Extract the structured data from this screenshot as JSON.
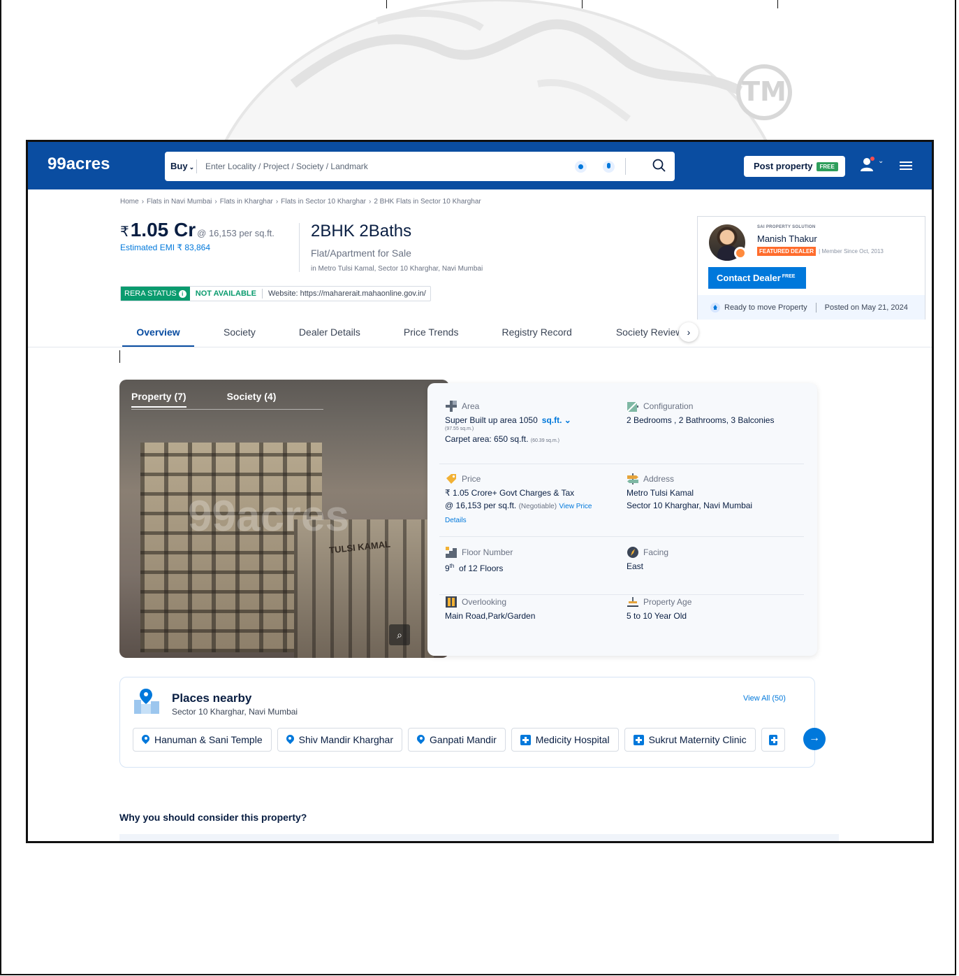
{
  "brand": {
    "logo_text": "99acres"
  },
  "search": {
    "mode": "Buy",
    "placeholder": "Enter Locality / Project / Society / Landmark"
  },
  "header": {
    "post_label": "Post property",
    "free_badge": "FREE"
  },
  "breadcrumb": [
    "Home",
    "Flats in Navi Mumbai",
    "Flats in Kharghar",
    "Flats in Sector 10 Kharghar",
    "2 BHK Flats in Sector 10 Kharghar"
  ],
  "property": {
    "currency": "₹",
    "price": "1.05 Cr",
    "price_per": "@ 16,153 per sq.ft.",
    "emi": "Estimated EMI ₹ 83,864",
    "title": "2BHK 2Baths",
    "subtitle": "Flat/Apartment for Sale",
    "location": "in Metro Tulsi Kamal, Sector 10 Kharghar, Navi Mumbai"
  },
  "rera": {
    "label": "RERA STATUS",
    "info": "i",
    "status": "NOT AVAILABLE",
    "website": "Website: https://maharerait.mahaonline.gov.in/"
  },
  "tabs": [
    "Overview",
    "Society",
    "Dealer Details",
    "Price Trends",
    "Registry Record",
    "Society Reviews"
  ],
  "tab_next": "›",
  "dealer": {
    "agency": "SAI PROPERTY SOLUTION",
    "name": "Manish Thakur",
    "badge": "FEATURED DEALER",
    "member_since": "| Member Since Oct, 2013",
    "contact_label": "Contact Dealer",
    "contact_free": "FREE",
    "status": "Ready to move Property",
    "posted": "Posted on May 21, 2024"
  },
  "gallery": {
    "tabs": [
      "Property (7)",
      "Society (4)"
    ],
    "watermark": "99acres",
    "sign_text": "TULSI KAMAL",
    "zoom": "⌕"
  },
  "details": {
    "area": {
      "label": "Area",
      "value": "Super Built up area 1050",
      "unit": "sq.ft. ⌄",
      "sub": "(97.55 sq.m.)",
      "carpet": "Carpet area: 650 sq.ft.",
      "carpet_sub": "(60.39 sq.m.)"
    },
    "configuration": {
      "label": "Configuration",
      "value": "2 Bedrooms , 2 Bathrooms, 3 Balconies"
    },
    "price": {
      "label": "Price",
      "line1": "₹ 1.05 Crore+ Govt Charges & Tax",
      "line2": "@ 16,153 per sq.ft.",
      "negotiable": "(Negotiable)",
      "link": "View Price Details"
    },
    "address": {
      "label": "Address",
      "line1": "Metro Tulsi Kamal",
      "line2": "Sector 10 Kharghar, Navi Mumbai"
    },
    "floor": {
      "label": "Floor Number",
      "floor": "9",
      "suffix": "th",
      "of": "of 12 Floors"
    },
    "facing": {
      "label": "Facing",
      "value": "East"
    },
    "overlooking": {
      "label": "Overlooking",
      "value": "Main Road,Park/Garden"
    },
    "age": {
      "label": "Property Age",
      "value": "5 to 10 Year Old"
    }
  },
  "places": {
    "title": "Places nearby",
    "subtitle": "Sector 10 Kharghar, Navi Mumbai",
    "view_all": "View All (50)",
    "items": [
      {
        "name": "Hanuman & Sani Temple",
        "icon": "pin-icon"
      },
      {
        "name": "Shiv Mandir Kharghar",
        "icon": "pin-icon"
      },
      {
        "name": "Ganpati Mandir",
        "icon": "pin-icon"
      },
      {
        "name": "Medicity Hospital",
        "icon": "hospital-icon"
      },
      {
        "name": "Sukrut Maternity Clinic",
        "icon": "hospital-icon"
      }
    ],
    "next": "→"
  },
  "why": {
    "title": "Why you should consider this property?"
  },
  "decor": {
    "tm": "TM"
  },
  "colors": {
    "header": "#0a4da1",
    "accent": "#0078db",
    "rera": "#0a9b6e",
    "featured": "#ff6c2c"
  }
}
